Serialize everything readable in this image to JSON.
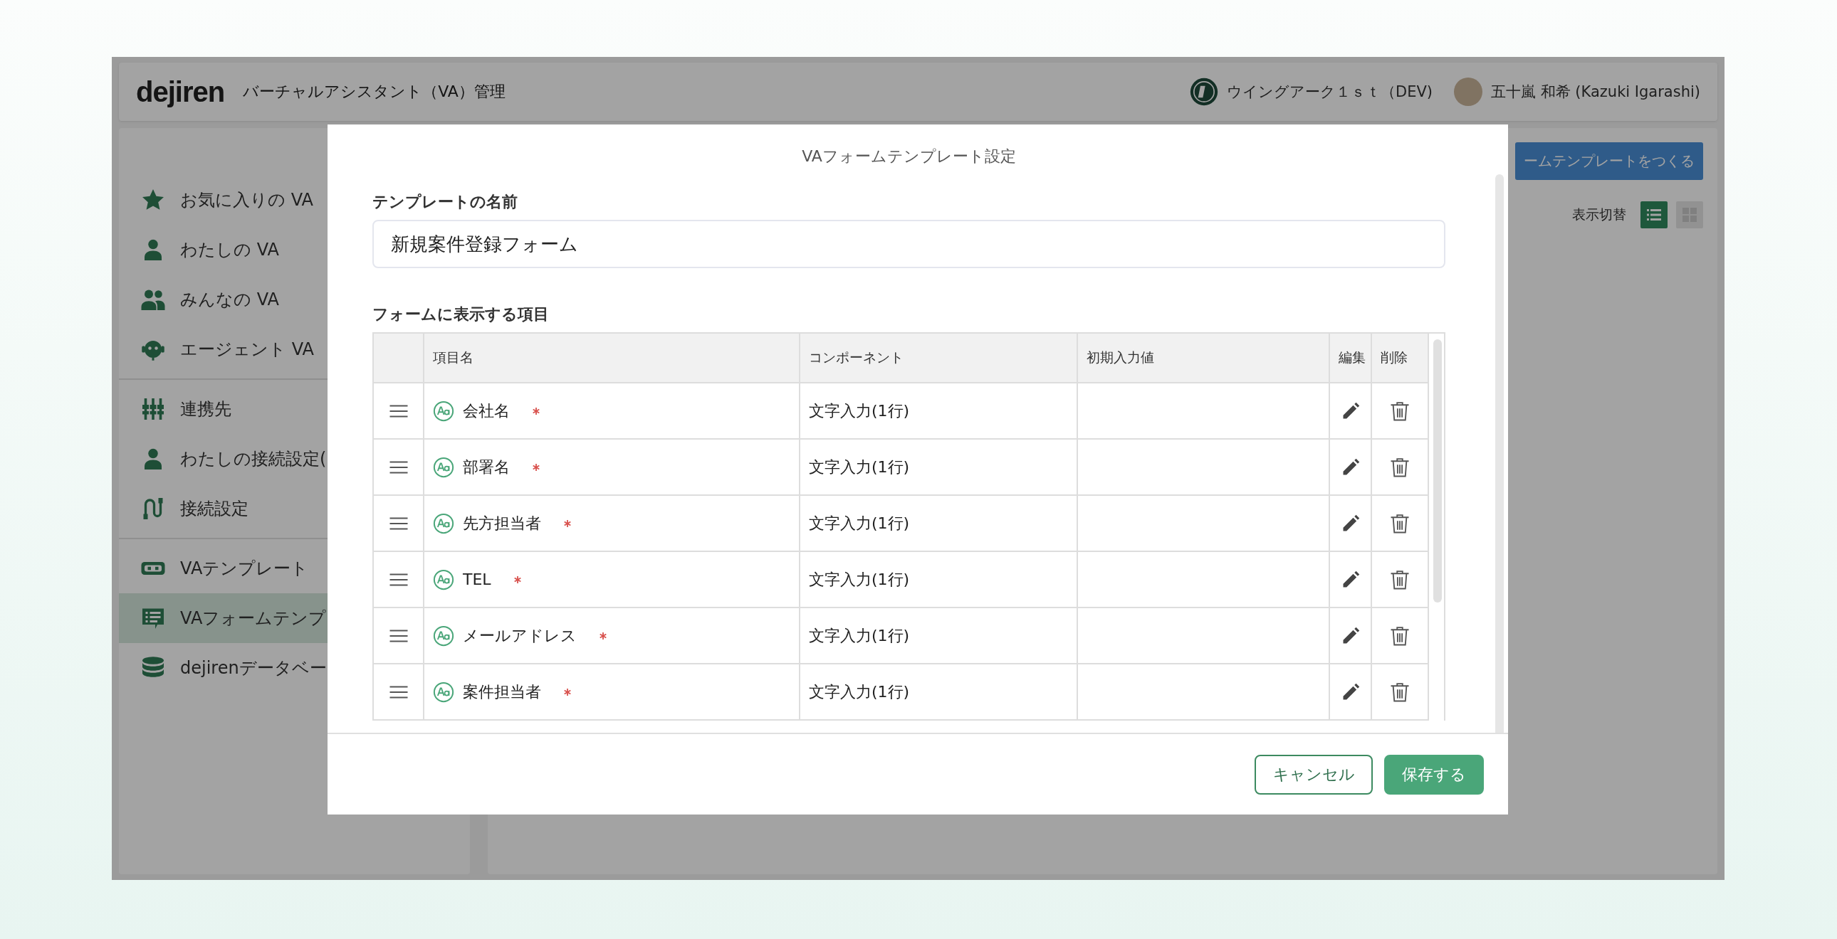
{
  "header": {
    "logo": "dejiren",
    "title": "バーチャルアシスタント（VA）管理",
    "organization": "ウイングアーク１ｓｔ（DEV)",
    "user": "五十嵐 和希 (Kazuki Igarashi)"
  },
  "sidebar": {
    "groups": [
      [
        {
          "label": "お気に入りの VA",
          "selected": false
        },
        {
          "label": "わたしの VA",
          "selected": false
        },
        {
          "label": "みんなの VA",
          "selected": false
        },
        {
          "label": "エージェント VA",
          "selected": false
        }
      ],
      [
        {
          "label": "連携先",
          "selected": false
        },
        {
          "label": "わたしの接続設定(",
          "selected": false
        },
        {
          "label": "接続設定",
          "selected": false
        }
      ],
      [
        {
          "label": "VAテンプレート",
          "selected": false
        },
        {
          "label": "VAフォームテンプ",
          "selected": true
        },
        {
          "label": "dejirenデータベー",
          "selected": false
        }
      ]
    ]
  },
  "main": {
    "create_button": "ームテンプレートをつくる",
    "view_toggle": {
      "label": "表示切替",
      "options": [
        {
          "selected": true
        },
        {
          "selected": false
        }
      ]
    }
  },
  "modal": {
    "title": "VAフォームテンプレート設定",
    "name_label": "テンプレートの名前",
    "name_value": "新規案件登録フォーム",
    "items_label": "フォームに表示する項目",
    "table": {
      "columns": [
        "項目名",
        "コンポーネント",
        "初期入力値",
        "編集",
        "削除"
      ],
      "rows": [
        {
          "name": "会社名",
          "required": true,
          "component": "文字入力(1行)"
        },
        {
          "name": "部署名",
          "required": true,
          "component": "文字入力(1行)"
        },
        {
          "name": "先方担当者",
          "required": true,
          "component": "文字入力(1行)"
        },
        {
          "name": "TEL",
          "required": true,
          "component": "文字入力(1行)"
        },
        {
          "name": "メールアドレス",
          "required": true,
          "component": "文字入力(1行)"
        },
        {
          "name": "案件担当者",
          "required": true,
          "component": "文字入力(1行)"
        }
      ]
    },
    "buttons": [
      {
        "label": "キャンセル",
        "kind": "secondary"
      },
      {
        "label": "保存する",
        "kind": "primary"
      }
    ]
  }
}
